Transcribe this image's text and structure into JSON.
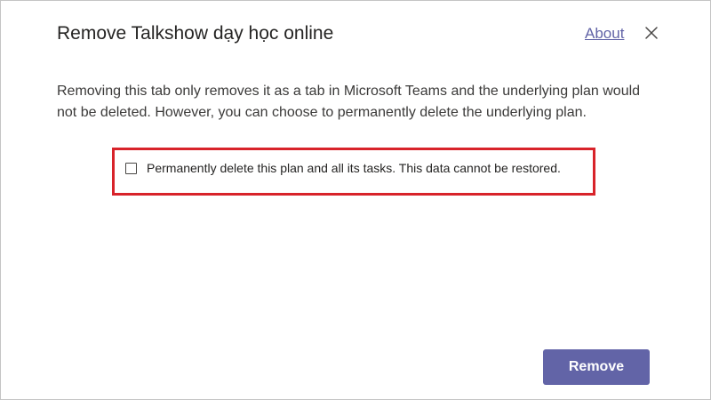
{
  "dialog": {
    "title": "Remove Talkshow dạy học online",
    "about_label": "About",
    "close_icon": "close-icon",
    "description": "Removing this tab only removes it as a tab in Microsoft Teams and the underlying plan would not be deleted. However, you can choose to permanently delete the underlying plan.",
    "checkbox": {
      "label": "Permanently delete this plan and all its tasks. This data cannot be restored.",
      "checked": false
    },
    "remove_label": "Remove"
  },
  "colors": {
    "accent": "#6264a7",
    "highlight": "#d8232a",
    "text": "#252423"
  }
}
